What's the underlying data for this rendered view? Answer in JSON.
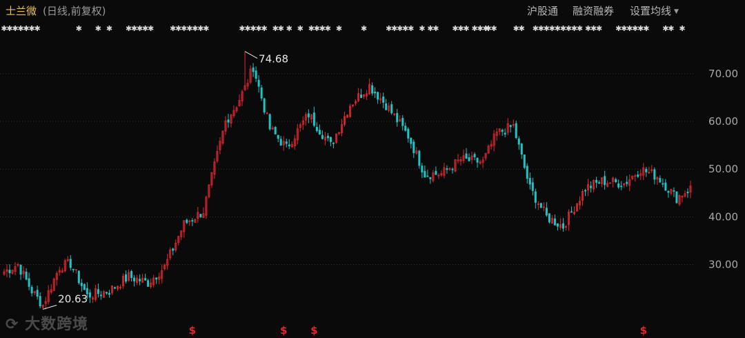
{
  "header": {
    "stock_name": "士兰微",
    "subtitle": "(日线,前复权)",
    "menu": [
      "沪股通",
      "融资融券",
      "设置均线"
    ]
  },
  "colors": {
    "up": "#e0282e",
    "down": "#20c4c4",
    "background": "#0a0a0a"
  },
  "chart_data": {
    "type": "candlestick",
    "ylim": [
      17.5,
      77.5
    ],
    "yticks": [
      30,
      40,
      50,
      60,
      70
    ],
    "ytick_labels": [
      "30.00",
      "40.00",
      "50.00",
      "60.00",
      "70.00"
    ],
    "grid": "horizontal-dotted",
    "annotations": [
      {
        "label": "74.68",
        "value": 74.68,
        "bar_index": 87
      },
      {
        "label": "20.63",
        "value": 20.63,
        "bar_index": 14
      }
    ],
    "close_anchors": [
      [
        0,
        28.5
      ],
      [
        5,
        30.0
      ],
      [
        10,
        24.5
      ],
      [
        14,
        21.5
      ],
      [
        20,
        29.5
      ],
      [
        24,
        30.2
      ],
      [
        30,
        23.5
      ],
      [
        38,
        24.5
      ],
      [
        45,
        27.5
      ],
      [
        52,
        26.2
      ],
      [
        58,
        29.5
      ],
      [
        65,
        38.5
      ],
      [
        72,
        41.2
      ],
      [
        80,
        60.0
      ],
      [
        84,
        63.5
      ],
      [
        87,
        67.0
      ],
      [
        90,
        71.5
      ],
      [
        96,
        58.5
      ],
      [
        102,
        54.5
      ],
      [
        110,
        61.5
      ],
      [
        118,
        55.0
      ],
      [
        125,
        63.5
      ],
      [
        132,
        67.5
      ],
      [
        138,
        63.5
      ],
      [
        146,
        57.0
      ],
      [
        152,
        49.0
      ],
      [
        158,
        49.0
      ],
      [
        165,
        52.0
      ],
      [
        173,
        51.5
      ],
      [
        178,
        57.5
      ],
      [
        184,
        59.0
      ],
      [
        190,
        46.0
      ],
      [
        196,
        40.0
      ],
      [
        202,
        38.0
      ],
      [
        210,
        46.0
      ],
      [
        216,
        47.5
      ],
      [
        224,
        47.0
      ],
      [
        230,
        50.0
      ],
      [
        236,
        48.5
      ],
      [
        243,
        44.0
      ],
      [
        248,
        46.0
      ]
    ],
    "event_markers": {
      "symbol": "✱",
      "bar_index": [
        0,
        2,
        4,
        6,
        8,
        10,
        12,
        27,
        34,
        38,
        45,
        47,
        49,
        51,
        53,
        61,
        63,
        65,
        67,
        69,
        71,
        73,
        86,
        88,
        90,
        92,
        94,
        98,
        100,
        103,
        107,
        111,
        113,
        115,
        117,
        121,
        130,
        139,
        141,
        143,
        145,
        147,
        151,
        154,
        156,
        163,
        165,
        167,
        170,
        172,
        174,
        175,
        177,
        185,
        187,
        192,
        194,
        196,
        198,
        200,
        202,
        204,
        206,
        208,
        211,
        213,
        215,
        222,
        224,
        226,
        228,
        230,
        232,
        239,
        241,
        245
      ]
    },
    "dividend_markers": {
      "symbol": "$",
      "bar_index": [
        68,
        101,
        112,
        231
      ]
    }
  },
  "watermark": "大数跨境"
}
